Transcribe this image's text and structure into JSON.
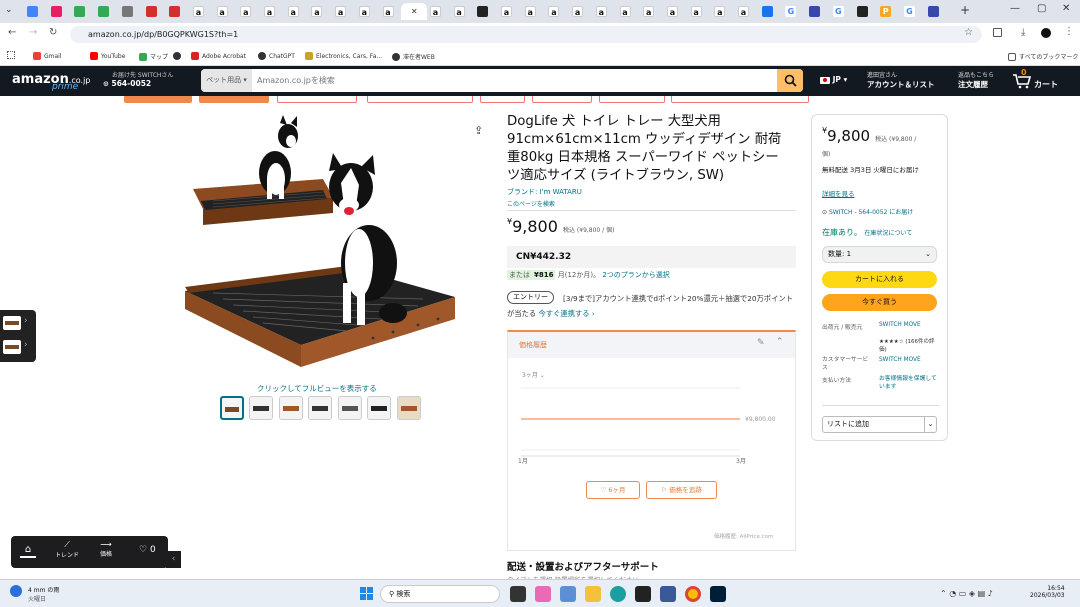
{
  "browser": {
    "url": "amazon.co.jp/dp/B0GQPKWG1S?th=1",
    "tab_favicons": [
      "chrome-icon",
      "flower-icon",
      "bookmark-icon",
      "bookmark-icon",
      "circle-icon",
      "red-icon",
      "red-icon",
      "amazon-a-icon",
      "amazon-a-icon",
      "amazon-a-icon",
      "amazon-a-icon",
      "amazon-a-icon",
      "amazon-a-icon",
      "amazon-a-icon",
      "amazon-a-icon",
      "amazon-a-icon",
      "close-icon",
      "amazon-a-icon",
      "amazon-a-icon",
      "dark-icon",
      "amazon-a-icon",
      "amazon-a-icon",
      "amazon-a-icon",
      "amazon-a-icon",
      "amazon-a-icon",
      "amazon-a-icon",
      "amazon-a-icon",
      "amazon-a-icon",
      "amazon-a-icon",
      "amazon-a-icon",
      "amazon-a-icon",
      "puzzle-icon",
      "google-icon",
      "blue-icon",
      "google-icon",
      "dark-icon",
      "p-icon",
      "google-icon",
      "blue-icon"
    ],
    "bookmarks": [
      "Gmail",
      "YouTube",
      "マップ",
      "",
      "Adobe Acrobat",
      "ChatGPT",
      "Electronics, Cars, Fa...",
      "滞在者WEB"
    ],
    "all_bookmarks": "すべてのブックマーク"
  },
  "amazon_header": {
    "logo": "amazon",
    "logo_suffix": ".co.jp",
    "prime": "prime",
    "deliver_line1": "お届け先 SWITCHさん",
    "deliver_line2": "564-0052",
    "search_category": "ペット用品",
    "search_placeholder": "Amazon.co.jpを検索",
    "lang": "JP",
    "account_line1": "進田宜さん",
    "account_line2": "アカウント＆リスト",
    "orders_line1": "返品もこちら",
    "orders_line2": "注文履歴",
    "cart_count": "0",
    "cart_label": "カート"
  },
  "product": {
    "title": "DogLife 犬 トイレ トレー 大型犬用 91cm×61cm×11cm ウッディデザイン 耐荷重80kg 日本規格 スーパーワイド ペットシーツ適応サイズ (ライトブラウン, SW)",
    "brand": "ブランド: I'm WATARU",
    "search_page": "このページを検索",
    "price_symbol": "¥",
    "price": "9,800",
    "price_note": "税込 (¥9,800 / 個)",
    "cny": "CN¥442.32",
    "installment_prefix": "または",
    "installment_amount": "¥816",
    "installment_suffix": "月(12か月)。",
    "installment_link": "2つのプランから選択",
    "entry_label": "エントリー",
    "promo_text": "[3/9まで]アカウント連携でdポイント20%還元＋抽選で20万ポイントが当たる",
    "promo_link": "今すぐ連携する",
    "click_full": "クリックしてフルビューを表示する",
    "thumb_count": "7"
  },
  "price_history": {
    "header": "価格履歴",
    "range": "3ヶ月",
    "price_label": "¥9,800.00",
    "x_start": "1月",
    "x_end": "3月",
    "btn_favorite": "6ヶ月",
    "btn_alert": "価格を追跡",
    "footer": "価格履歴: AliPrice.com"
  },
  "chart_data": {
    "type": "line",
    "x": [
      "1月",
      "3月"
    ],
    "series": [
      {
        "values": [
          9800,
          9800
        ]
      }
    ]
  },
  "delivery_section": {
    "title": "配送・設置およびアフターサポート",
    "sub": "タイプトを選択 設置場所を選択してください"
  },
  "buybox": {
    "price": "9,800",
    "price_note": "税込 (¥9,800 /",
    "price_note2": "個)",
    "delivery": "無料配送 3月3日 火曜日にお届け",
    "details": "詳細を見る",
    "location": "SWITCH - 564-0052 にお届け",
    "stock": "在庫あり。",
    "stock_link": "在庫状況について",
    "qty_label": "数量: 1",
    "add_cart": "カートに入れる",
    "buy_now": "今すぐ買う",
    "seller_label": "出荷元 / 販売元",
    "seller_value": "SWITCH MOVE",
    "rating_text": "★★★★☆ (166件の評価)",
    "cs_label": "カスタマーサービス",
    "cs_value": "SWITCH MOVE",
    "pay_label": "支払い方法",
    "pay_value": "お客様情報を保護しています",
    "add_list": "リストに追加"
  },
  "tool": {
    "trend": "トレンド",
    "price": "価格",
    "count": "0"
  },
  "taskbar": {
    "weather_temp": "4 mm の雨",
    "weather_sub": "火曜日",
    "search": "検索",
    "time": "16:54",
    "date": "2026/03/03"
  }
}
